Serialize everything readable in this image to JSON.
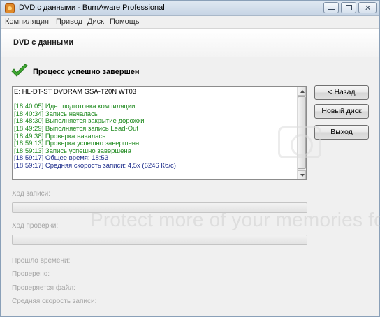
{
  "window": {
    "title": "DVD с данными - BurnAware Professional"
  },
  "menu": [
    "Компиляция",
    "Привод",
    "Диск",
    "Помощь"
  ],
  "header": {
    "title": "DVD с данными"
  },
  "status": {
    "icon": "check-icon",
    "text": "Процесс успешно завершен",
    "accent": "#3fa832"
  },
  "log": {
    "drive": "E: HL-DT-ST DVDRAM GSA-T20N WT03",
    "lines": [
      {
        "text": "[18:40:05] Идет подготовка компиляции",
        "color": "green"
      },
      {
        "text": "[18:40:34] Запись началась",
        "color": "green"
      },
      {
        "text": "[18:48:30] Выполняется закрытие дорожки",
        "color": "green"
      },
      {
        "text": "[18:49:29] Выполняется запись Lead-Out",
        "color": "green"
      },
      {
        "text": "[18:49:38] Проверка началась",
        "color": "green"
      },
      {
        "text": "[18:59:13] Проверка успешно завершена",
        "color": "green"
      },
      {
        "text": "[18:59:13] Запись успешно завершена",
        "color": "green"
      },
      {
        "text": "[18:59:17] Общее время: 18:53",
        "color": "blue"
      },
      {
        "text": "[18:59:17] Средняя скорость записи: 4,5x (6246 Кб/с)",
        "color": "blue"
      }
    ]
  },
  "buttons": {
    "back": "< Назад",
    "new_disc": "Новый диск",
    "exit": "Выход"
  },
  "progress": {
    "write_label": "Ход записи:",
    "write_value": 0,
    "verify_label": "Ход проверки:",
    "verify_value": 0
  },
  "info": {
    "elapsed": "Прошло времени:",
    "verified": "Проверено:",
    "checking_file": "Проверяется файл:",
    "avg_speed": "Средняя скорость записи:"
  },
  "watermark": "Protect more of your memories for less!"
}
